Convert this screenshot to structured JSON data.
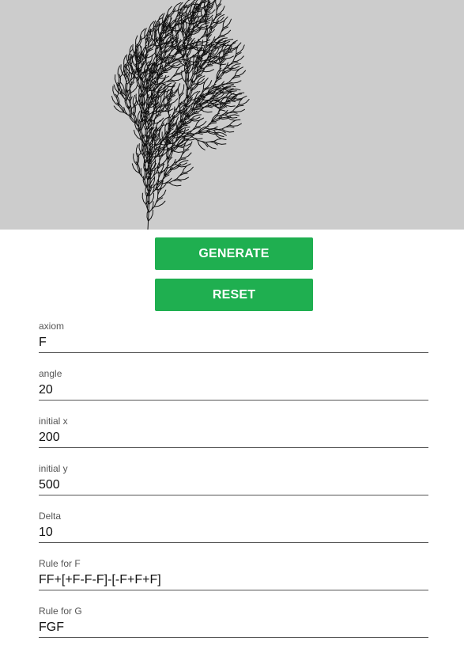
{
  "buttons": {
    "generate": "GENERATE",
    "reset": "RESET"
  },
  "fields": [
    {
      "label": "axiom",
      "value": "F"
    },
    {
      "label": "angle",
      "value": "20"
    },
    {
      "label": "initial x",
      "value": "200"
    },
    {
      "label": "initial y",
      "value": "500"
    },
    {
      "label": "Delta",
      "value": "10"
    },
    {
      "label": "Rule for F",
      "value": "FF+[+F-F-F]-[-F+F+F]"
    },
    {
      "label": "Rule for G",
      "value": "FGF"
    }
  ],
  "colors": {
    "canvas_bg": "#cccccc",
    "button_bg": "#1faf50",
    "stroke": "#111111"
  }
}
